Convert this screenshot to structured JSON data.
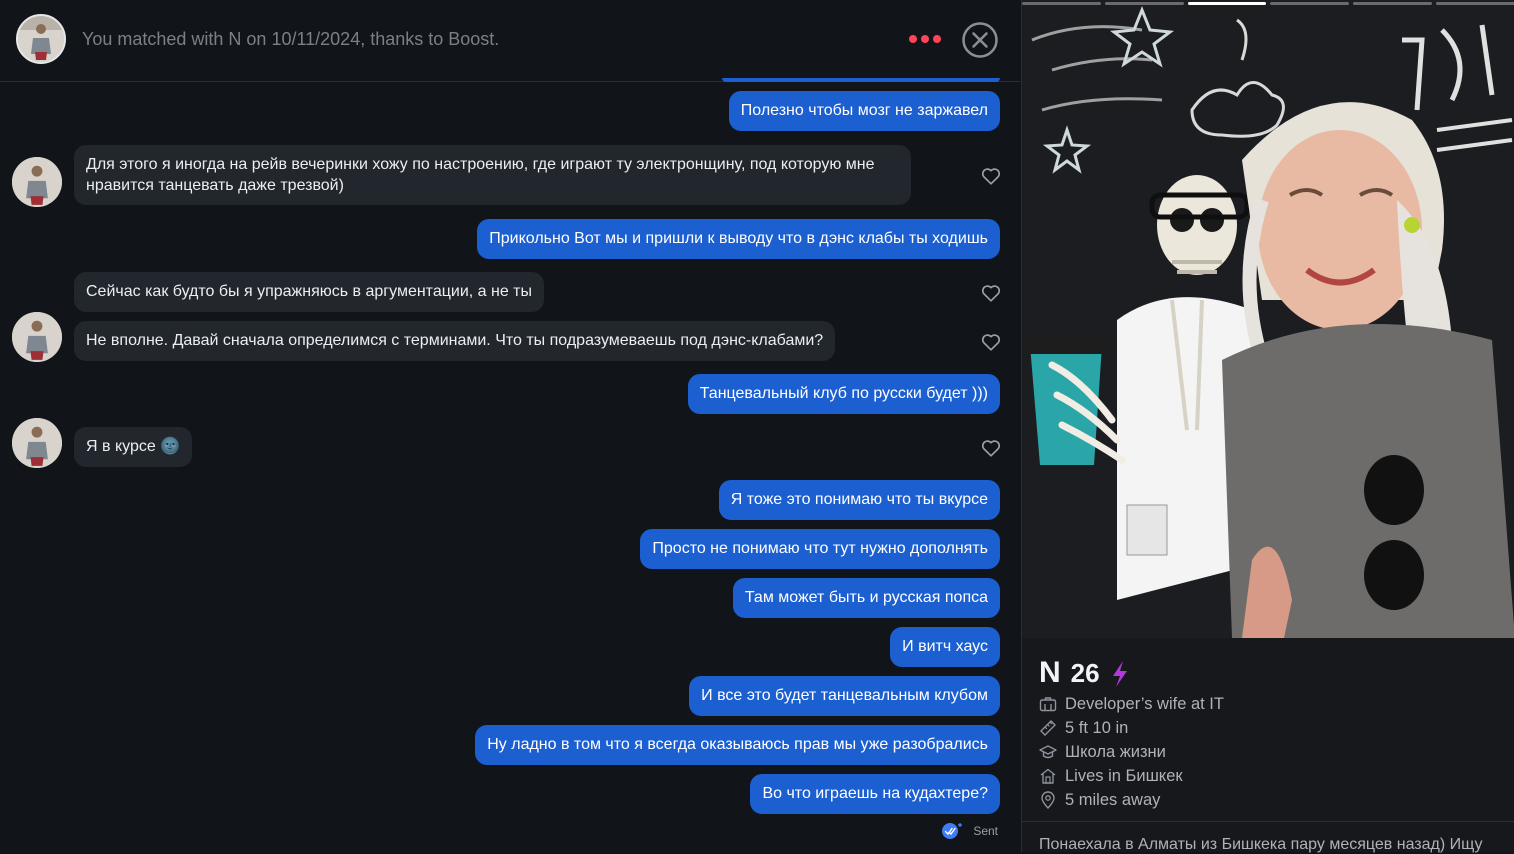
{
  "header": {
    "match_text": "You matched with N on 10/11/2024, thanks to Boost."
  },
  "messages": [
    {
      "dir": "out",
      "text": "Полезно чтобы мозг не заржавел"
    },
    {
      "dir": "in",
      "text": "Для этого я иногда на рейв вечеринки хожу по настроению, где играют ту электронщину, под которую мне нравится танцевать даже трезвой)"
    },
    {
      "dir": "out",
      "text": "Прикольно Вот мы и пришли к выводу что в дэнс клабы ты ходишь"
    },
    {
      "dir": "in",
      "text": "Сейчас как будто бы я упражняюсь в аргументации, а не ты"
    },
    {
      "dir": "in",
      "text": "Не вполне. Давай сначала определимся с терминами. Что ты подразумеваешь под дэнс-клабами?"
    },
    {
      "dir": "out",
      "text": "Танцевальный клуб по русски будет )))"
    },
    {
      "dir": "in",
      "text": "Я в курсе 🌚"
    },
    {
      "dir": "out",
      "text": "Я тоже это понимаю что ты вкурсе"
    },
    {
      "dir": "out",
      "text": "Просто не понимаю что тут нужно дополнять"
    },
    {
      "dir": "out",
      "text": "Там может быть и русская попса"
    },
    {
      "dir": "out",
      "text": "И витч хаус"
    },
    {
      "dir": "out",
      "text": "И все это будет танцевальным клубом"
    },
    {
      "dir": "out",
      "text": "Ну ладно в том что я всегда оказываюсь прав мы уже разобрались"
    },
    {
      "dir": "out",
      "text": "Во что играешь на кудахтере?"
    }
  ],
  "status": {
    "sent_label": "Sent"
  },
  "profile": {
    "name": "N",
    "age": "26",
    "job": "Developer’s wife at IT",
    "height": "5 ft 10 in",
    "school": "Школа жизни",
    "lives": "Lives in Бишкек",
    "distance": "5 miles away",
    "bio": "Понаехала в Алматы из Бишкека пару месяцев назад) Ищу"
  },
  "icons": {
    "more": "more-dots-icon",
    "close": "close-circle-icon",
    "like": "heart-outline-icon",
    "boost": "lightning-bolt-icon",
    "job": "briefcase-icon",
    "height": "ruler-icon",
    "school": "graduation-cap-icon",
    "lives": "house-icon",
    "distance": "location-pin-icon",
    "read": "read-receipt-icon"
  },
  "colors": {
    "outgoing_bubble": "#1b5fd1",
    "incoming_bubble": "#22262d",
    "more_dots": "#ff4458",
    "boost": "#b23ad6",
    "read_receipt": "#3f7cf5"
  }
}
